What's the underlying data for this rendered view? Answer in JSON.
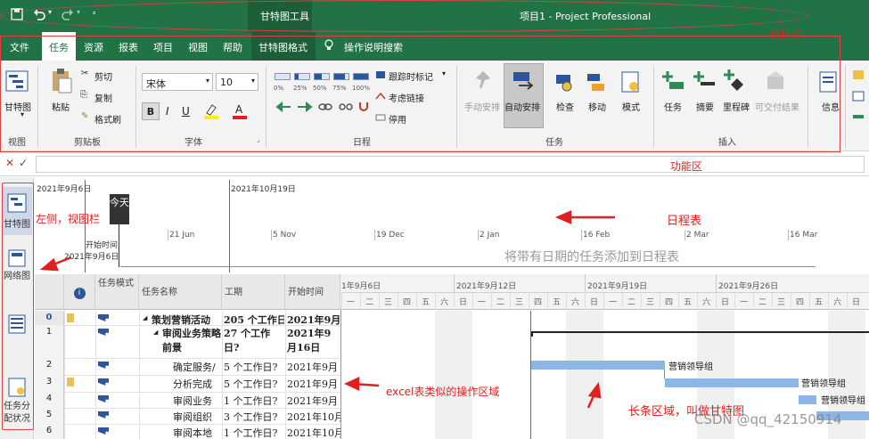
{
  "titlebar": {
    "context_group": "甘特图工具",
    "window_title": "项目1 - Project Professional"
  },
  "tabs": [
    "文件",
    "任务",
    "资源",
    "报表",
    "项目",
    "视图",
    "帮助",
    "甘特图格式"
  ],
  "tell_me": "操作说明搜索",
  "ribbon": {
    "view": {
      "gantt": "甘特图",
      "group": "视图"
    },
    "clipboard": {
      "paste": "粘贴",
      "cut": "剪切",
      "copy": "复制",
      "format_painter": "格式刷",
      "group": "剪贴板"
    },
    "font": {
      "name": "宋体",
      "size": "10",
      "bold": "B",
      "italic": "I",
      "underline": "U",
      "group": "字体"
    },
    "schedule": {
      "pct": [
        "0%",
        "25%",
        "50%",
        "75%",
        "100%"
      ],
      "track": "跟踪时标记",
      "respect_links": "考虑链接",
      "inactivate": "停用",
      "group": "日程"
    },
    "tasks": {
      "manual": "手动安排",
      "auto": "自动安排",
      "inspect": "检查",
      "move": "移动",
      "mode": "模式",
      "group": "任务"
    },
    "insert": {
      "task": "任务",
      "summary": "摘要",
      "milestone": "里程碑",
      "deliverable": "可交付结果",
      "info": "信息",
      "group": "插入"
    }
  },
  "viewbar": [
    "甘特图",
    "网络图",
    "任务分配状况"
  ],
  "timeline": {
    "start_date": "2021年9月6日",
    "today": "今天",
    "finish_date": "2021年10月19日",
    "start_label": "开始时间",
    "start_value": "2021年9月6日",
    "ticks": [
      "21 Jun",
      "5 Nov",
      "19 Dec",
      "2 Jan",
      "16 Feb",
      "2 Mar",
      "16 Mar",
      "2 Apr"
    ],
    "hint": "将带有日期的任务添加到日程表"
  },
  "table": {
    "headers": {
      "info": "i",
      "mode": "任务模式",
      "name": "任务名称",
      "duration": "工期",
      "start": "开始时间"
    },
    "rows": [
      {
        "id": "0",
        "name": "策划营销活动",
        "duration": "205 个工作日",
        "start": "2021年9月",
        "level": 0
      },
      {
        "id": "1",
        "name": "审阅业务策略前景",
        "duration": "27 个工作日?",
        "start": "2021年9月16日",
        "level": 1
      },
      {
        "id": "2",
        "name": "确定服务/",
        "duration": "5 个工作日?",
        "start": "2021年9月",
        "level": 2
      },
      {
        "id": "3",
        "name": "分析完成",
        "duration": "5 个工作日?",
        "start": "2021年9月",
        "level": 2
      },
      {
        "id": "4",
        "name": "审阅业务",
        "duration": "1 个工作日?",
        "start": "2021年9月",
        "level": 2
      },
      {
        "id": "5",
        "name": "审阅组织",
        "duration": "3 个工作日?",
        "start": "2021年10月",
        "level": 2
      },
      {
        "id": "6",
        "name": "审阅本地",
        "duration": "1 个工作日?",
        "start": "2021年10月",
        "level": 2
      }
    ]
  },
  "gantt": {
    "weeks": [
      "1年9月6日",
      "2021年9月12日",
      "2021年9月19日",
      "2021年9月26日"
    ],
    "days": [
      "一",
      "二",
      "三",
      "四",
      "五",
      "六",
      "日"
    ],
    "bar_labels": [
      "营销领导组",
      "营销领导组",
      "营销领导组"
    ]
  },
  "annotations": {
    "title_bar": "标题栏",
    "ribbon": "功能区",
    "left_bar": "左侧，视图栏",
    "timeline": "日程表",
    "table": "excel表类似的操作区域",
    "gantt": "长条区域，叫做甘特图"
  },
  "watermark": "CSDN @qq_42150914",
  "colors": {
    "brand": "#217346",
    "bar": "#8bb6e6",
    "annotation": "#e02020"
  }
}
